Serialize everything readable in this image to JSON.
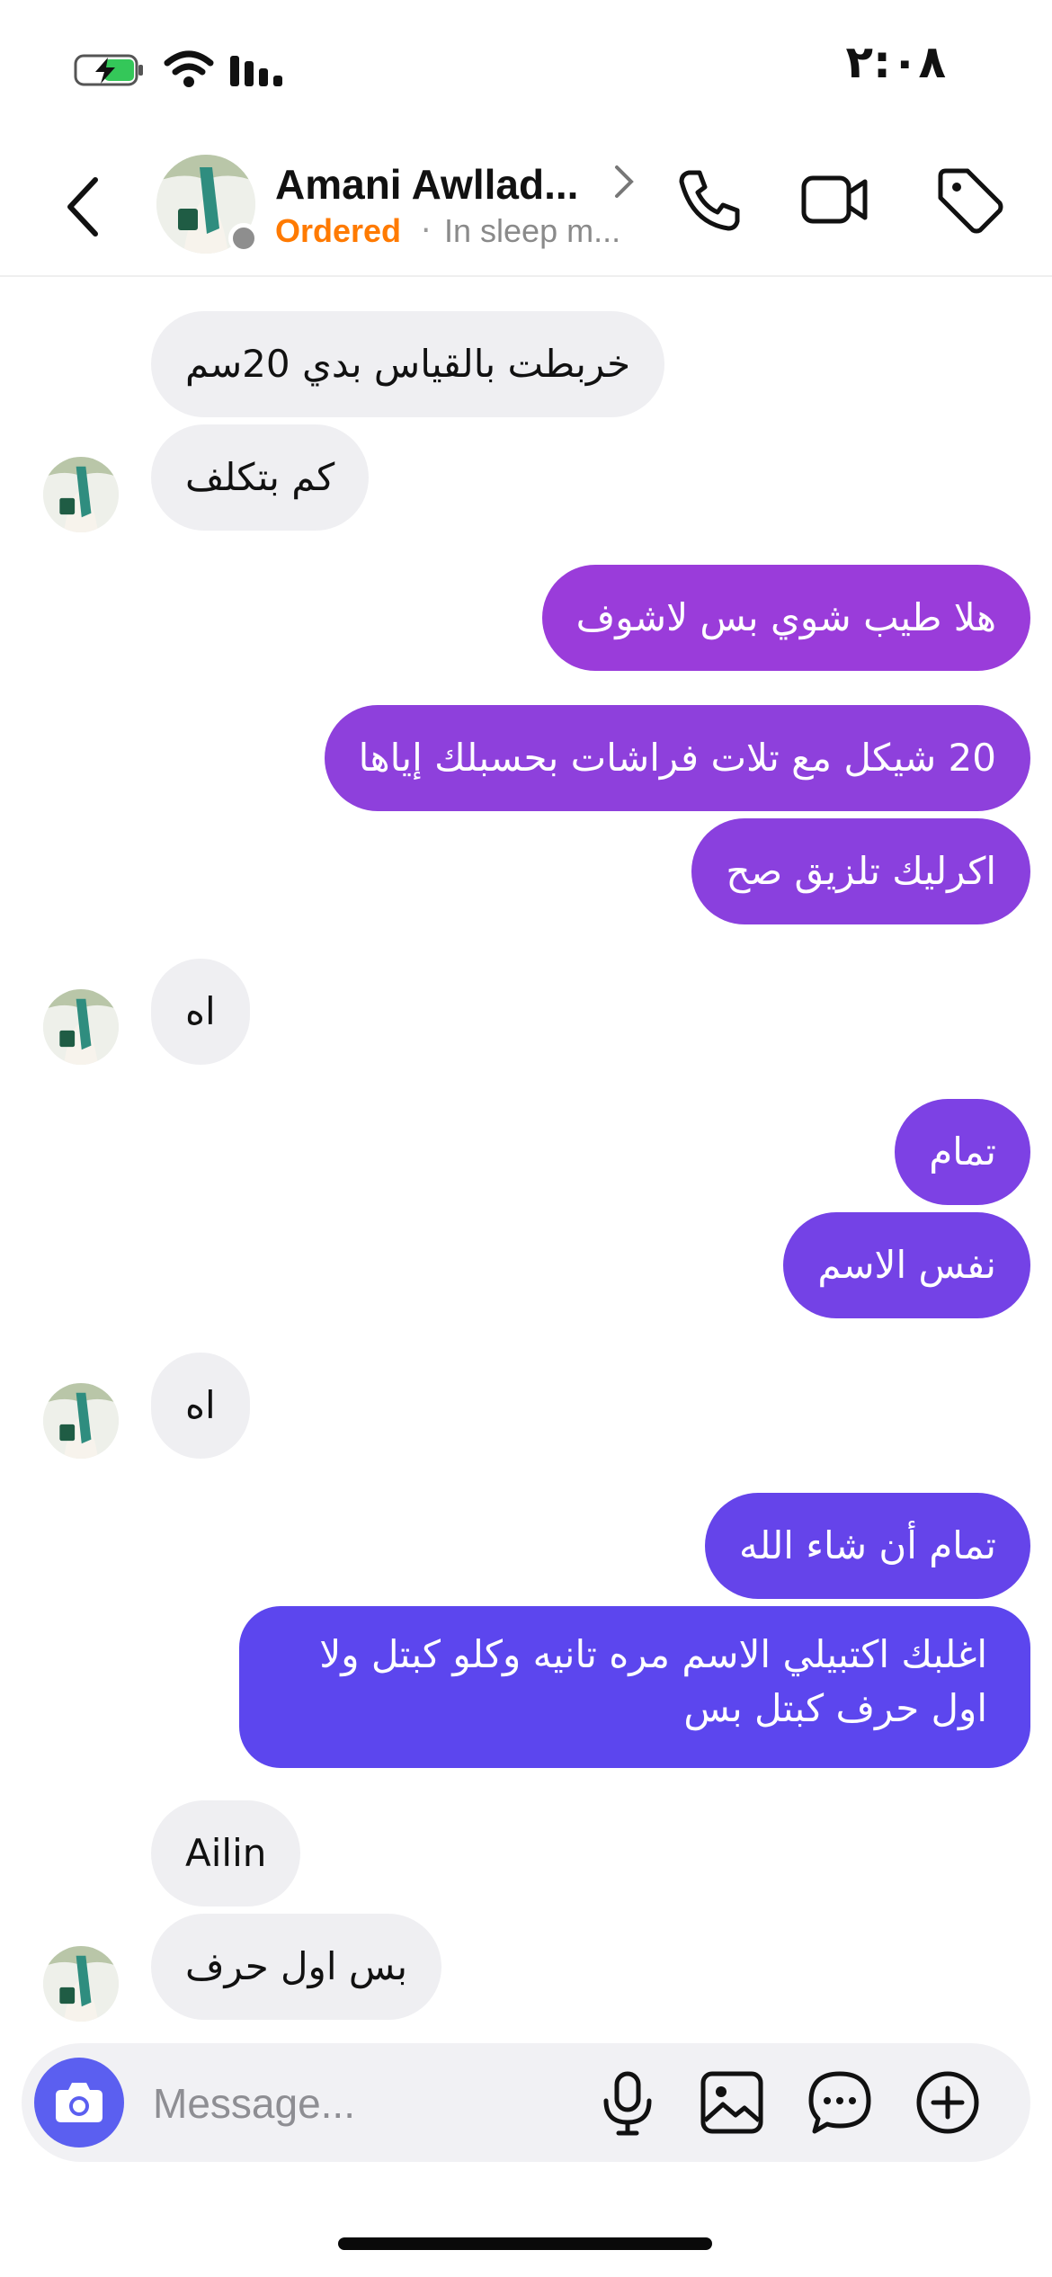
{
  "status_bar": {
    "time": "٢:٠٨"
  },
  "header": {
    "contact_name": "Amani Awllad...",
    "tag": "Ordered",
    "separator": "·",
    "status": "In sleep m..."
  },
  "messages": [
    {
      "side": "in",
      "text": "خربطت بالقياس بدي 20سم"
    },
    {
      "side": "in",
      "text": "كم بتكلف"
    },
    {
      "side": "out",
      "text": "هلا طيب شوي بس لاشوف"
    },
    {
      "side": "out",
      "text": "20 شيكل مع تلات فراشات بحسبلك إياها"
    },
    {
      "side": "out",
      "text": "اكرليك تلزيق صح"
    },
    {
      "side": "in",
      "text": "اه"
    },
    {
      "side": "out",
      "text": "تمام"
    },
    {
      "side": "out",
      "text": "نفس الاسم"
    },
    {
      "side": "in",
      "text": "اه"
    },
    {
      "side": "out",
      "text": "تمام أن شاء الله"
    },
    {
      "side": "out",
      "text": "اغلبك اكتبيلي الاسم مره تانيه وكلو كبتل ولا اول حرف كبتل بس"
    },
    {
      "side": "in",
      "text": "Ailin"
    },
    {
      "side": "in",
      "text": "بس اول حرف"
    }
  ],
  "composer": {
    "placeholder": "Message..."
  },
  "colors": {
    "accent": "#5b5ff0",
    "ordered": "#ff7a00",
    "incoming_bubble": "#efeff2",
    "outgoing_gradient": [
      "#9b36d8",
      "#5a46f0"
    ]
  },
  "icons": [
    "battery-charging-icon",
    "wifi-icon",
    "signal-icon",
    "back-chevron-icon",
    "phone-icon",
    "video-icon",
    "tag-icon",
    "camera-icon",
    "microphone-icon",
    "image-icon",
    "chat-bubble-icon",
    "plus-circle-icon"
  ]
}
